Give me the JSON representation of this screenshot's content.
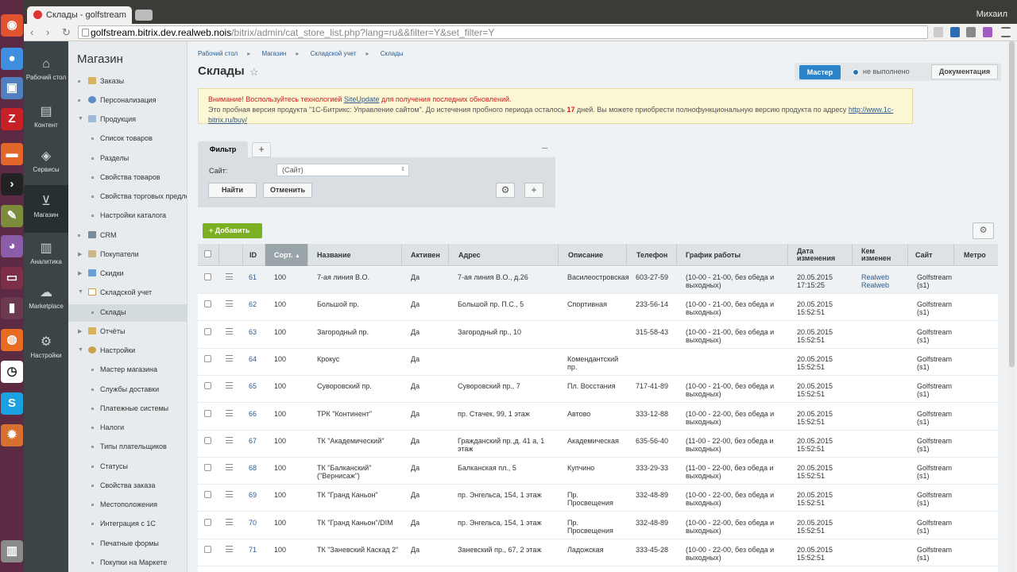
{
  "browser": {
    "tab_title": "Склады - golfstream",
    "user": "Михаил",
    "url_host": "golfstream.bitrix.dev.realweb.nois",
    "url_path": "/bitrix/admin/cat_store_list.php?lang=ru&&filter=Y&set_filter=Y"
  },
  "main_menu": [
    {
      "label": "Рабочий стол",
      "icon": "home-icon"
    },
    {
      "label": "Контент",
      "icon": "document-icon"
    },
    {
      "label": "Сервисы",
      "icon": "layers-icon"
    },
    {
      "label": "Магазин",
      "icon": "basket-icon"
    },
    {
      "label": "Аналитика",
      "icon": "bar-chart-icon"
    },
    {
      "label": "Marketplace",
      "icon": "cloud-download-icon"
    },
    {
      "label": "Настройки",
      "icon": "gear-icon"
    }
  ],
  "submenu": {
    "title": "Магазин",
    "items": [
      {
        "label": "Заказы"
      },
      {
        "label": "Персонализация"
      },
      {
        "label": "Продукция"
      },
      {
        "label": "Список товаров"
      },
      {
        "label": "Разделы"
      },
      {
        "label": "Свойства товаров"
      },
      {
        "label": "Свойства торговых предло"
      },
      {
        "label": "Настройки каталога"
      },
      {
        "label": "CRM"
      },
      {
        "label": "Покупатели"
      },
      {
        "label": "Скидки"
      },
      {
        "label": "Складской учет"
      },
      {
        "label": "Склады"
      },
      {
        "label": "Отчёты"
      },
      {
        "label": "Настройки"
      },
      {
        "label": "Мастер магазина"
      },
      {
        "label": "Службы доставки"
      },
      {
        "label": "Платежные системы"
      },
      {
        "label": "Налоги"
      },
      {
        "label": "Типы плательщиков"
      },
      {
        "label": "Статусы"
      },
      {
        "label": "Свойства заказа"
      },
      {
        "label": "Местоположения"
      },
      {
        "label": "Интеграция с 1С"
      },
      {
        "label": "Печатные формы"
      },
      {
        "label": "Покупки на Маркете"
      }
    ]
  },
  "breadcrumb": [
    "Рабочий стол",
    "Магазин",
    "Складской учет",
    "Склады"
  ],
  "page_title": "Склады",
  "master": {
    "button": "Мастер",
    "status": "не выполнено",
    "docs": "Документация"
  },
  "notice": {
    "warn_prefix": "Внимание! Воспользуйтесь технологией ",
    "warn_link": "SiteUpdate",
    "warn_suffix": " для получения последних обновлений.",
    "trial_prefix": "Это пробная версия продукта \"1С-Битрикс: Управление сайтом\". До истечения пробного периода осталось ",
    "trial_days": "17",
    "trial_suffix": " дней. Вы можете приобрести полнофункциональную версию продукта по адресу ",
    "trial_link": "http://www.1c-bitrix.ru/buy/"
  },
  "filter": {
    "tab": "Фильтр",
    "site_label": "Сайт:",
    "site_value": "(Сайт)",
    "find": "Найти",
    "cancel": "Отменить"
  },
  "add_button": "Добавить",
  "table": {
    "headers": [
      "ID",
      "Сорт.",
      "Название",
      "Активен",
      "Адрес",
      "Описание",
      "Телефон",
      "График работы",
      "Дата изменения",
      "Кем изменен",
      "Сайт",
      "Метро"
    ],
    "rows": [
      {
        "id": "61",
        "sort": "100",
        "name": "7-ая линия В.О.",
        "active": "Да",
        "address": "7-ая линия В.О., д.26",
        "desc": "Василеостровская",
        "phone": "603-27-59",
        "schedule": "(10-00 - 21-00, без обеда и выходных)",
        "date": "20.05.2015 17:15:25",
        "by": "Realweb Realweb",
        "site": "Golfstream (s1)"
      },
      {
        "id": "62",
        "sort": "100",
        "name": "Большой пр.",
        "active": "Да",
        "address": "Большой пр. П.С., 5",
        "desc": "Спортивная",
        "phone": "233-56-14",
        "schedule": "(10-00 - 21-00, без обеда и выходных)",
        "date": "20.05.2015 15:52:51",
        "by": "",
        "site": "Golfstream (s1)"
      },
      {
        "id": "63",
        "sort": "100",
        "name": "Загородный пр.",
        "active": "Да",
        "address": "Загородный пр., 10",
        "desc": "",
        "phone": "315-58-43",
        "schedule": "(10-00 - 21-00, без обеда и выходных)",
        "date": "20.05.2015 15:52:51",
        "by": "",
        "site": "Golfstream (s1)"
      },
      {
        "id": "64",
        "sort": "100",
        "name": "Крокус",
        "active": "Да",
        "address": "",
        "desc": "Комендантский пр.",
        "phone": "",
        "schedule": "",
        "date": "20.05.2015 15:52:51",
        "by": "",
        "site": "Golfstream (s1)"
      },
      {
        "id": "65",
        "sort": "100",
        "name": "Суворовский пр.",
        "active": "Да",
        "address": "Суворовский пр., 7",
        "desc": "Пл. Восстания",
        "phone": "717-41-89",
        "schedule": "(10-00 - 21-00, без обеда и выходных)",
        "date": "20.05.2015 15:52:51",
        "by": "",
        "site": "Golfstream (s1)"
      },
      {
        "id": "66",
        "sort": "100",
        "name": "ТРК \"Континент\"",
        "active": "Да",
        "address": "пр. Стачек, 99, 1 этаж",
        "desc": "Автово",
        "phone": "333-12-88",
        "schedule": "(10-00 - 22-00, без обеда и выходных)",
        "date": "20.05.2015 15:52:51",
        "by": "",
        "site": "Golfstream (s1)"
      },
      {
        "id": "67",
        "sort": "100",
        "name": "ТК \"Академический\"",
        "active": "Да",
        "address": "Гражданский пр.,д. 41 а, 1 этаж",
        "desc": "Академическая",
        "phone": "635-56-40",
        "schedule": "(11-00 - 22-00, без обеда и выходных)",
        "date": "20.05.2015 15:52:51",
        "by": "",
        "site": "Golfstream (s1)"
      },
      {
        "id": "68",
        "sort": "100",
        "name": "ТК \"Балканский\" (\"Вернисаж\")",
        "active": "Да",
        "address": "Балканская пл., 5",
        "desc": "Купчино",
        "phone": "333-29-33",
        "schedule": "(11-00 - 22-00, без обеда и выходных)",
        "date": "20.05.2015 15:52:51",
        "by": "",
        "site": "Golfstream (s1)"
      },
      {
        "id": "69",
        "sort": "100",
        "name": "ТК \"Гранд Каньон\"",
        "active": "Да",
        "address": "пр. Энгельса, 154, 1 этаж",
        "desc": "Пр. Просвещения",
        "phone": "332-48-89",
        "schedule": "(10-00 - 22-00, без обеда и выходных)",
        "date": "20.05.2015 15:52:51",
        "by": "",
        "site": "Golfstream (s1)"
      },
      {
        "id": "70",
        "sort": "100",
        "name": "ТК \"Гранд Каньон\"/DIM",
        "active": "Да",
        "address": "пр. Энгельса, 154, 1 этаж",
        "desc": "Пр. Просвещения",
        "phone": "332-48-89",
        "schedule": "(10-00 - 22-00, без обеда и выходных)",
        "date": "20.05.2015 15:52:51",
        "by": "",
        "site": "Golfstream (s1)"
      },
      {
        "id": "71",
        "sort": "100",
        "name": "ТК \"Заневский Каскад 2\"",
        "active": "Да",
        "address": "Заневский пр., 67, 2 этаж",
        "desc": "Ладожская",
        "phone": "333-45-28",
        "schedule": "(10-00 - 22-00, без обеда и выходных)",
        "date": "20.05.2015 15:52:51",
        "by": "",
        "site": "Golfstream (s1)"
      }
    ]
  },
  "colors": {
    "accent": "#2b84c9",
    "add": "#7ab021",
    "launcher": "#5c2b43",
    "menu": "#3b4548"
  }
}
